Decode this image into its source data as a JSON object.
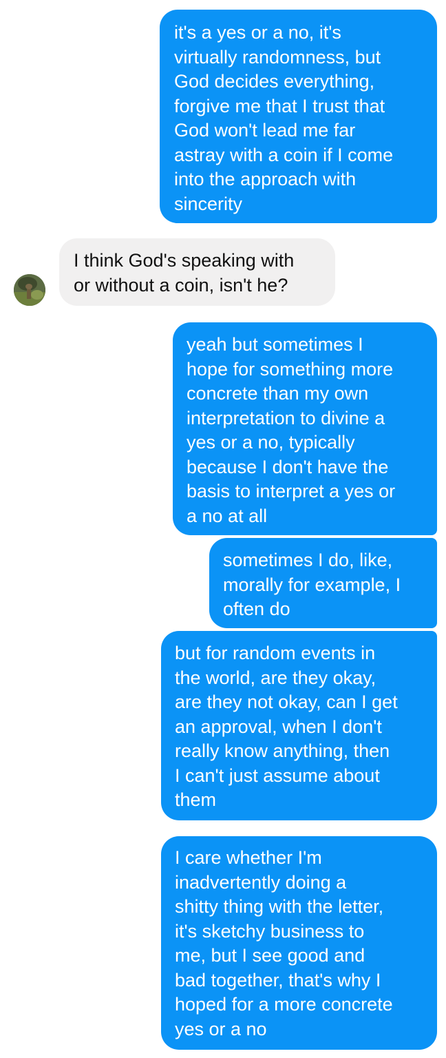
{
  "conversation": {
    "messages": [
      {
        "direction": "sent",
        "text": "it's a yes or a no, it's\nvirtually randomness, but\nGod decides everything,\nforgive me that I trust that\nGod won't lead me far\nastray with a coin if I come\ninto the approach with\nsincerity"
      },
      {
        "direction": "received",
        "text": "I think God's speaking with\nor without a coin, isn't he?"
      },
      {
        "direction": "sent",
        "text": "yeah but sometimes I\nhope for something more\nconcrete than my own\ninterpretation to divine a\nyes or a no, typically\nbecause I don't have the\nbasis to interpret a yes or\na no at all"
      },
      {
        "direction": "sent",
        "text": "sometimes I do, like,\nmorally for example, I\noften do"
      },
      {
        "direction": "sent",
        "text": "but for random events in\nthe world, are they okay,\nare they not okay, can I get\nan approval, when I don't\nreally know anything, then\nI can't just assume about\nthem"
      },
      {
        "direction": "sent",
        "text": "I care whether I'm\ninadvertently doing a\nshitty thing with the letter,\nit's sketchy business to\nme, but I see good and\nbad together, that's why I\nhoped for a more concrete\nyes or a no"
      }
    ]
  },
  "colors": {
    "sent_bubble": "#0b93f6",
    "received_bubble": "#f1f0f0"
  }
}
